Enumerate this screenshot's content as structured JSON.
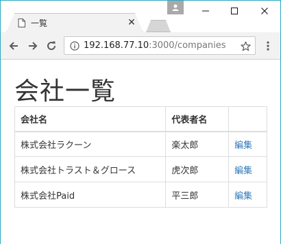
{
  "browser": {
    "tab_title": "一覧",
    "url_host": "192.168.77.10",
    "url_path": ":3000/companies"
  },
  "page": {
    "title": "会社一覧",
    "table": {
      "headers": [
        "会社名",
        "代表者名",
        ""
      ],
      "rows": [
        {
          "name": "株式会社ラクーン",
          "representative": "楽太郎",
          "action": "編集"
        },
        {
          "name": "株式会社トラスト＆グロース",
          "representative": "虎次郎",
          "action": "編集"
        },
        {
          "name": "株式会社Paid",
          "representative": "平三郎",
          "action": "編集"
        }
      ]
    }
  },
  "colors": {
    "window_border": "#2aa9c2",
    "link": "#337ab7",
    "toolbar_bg": "#f2f2f2"
  }
}
